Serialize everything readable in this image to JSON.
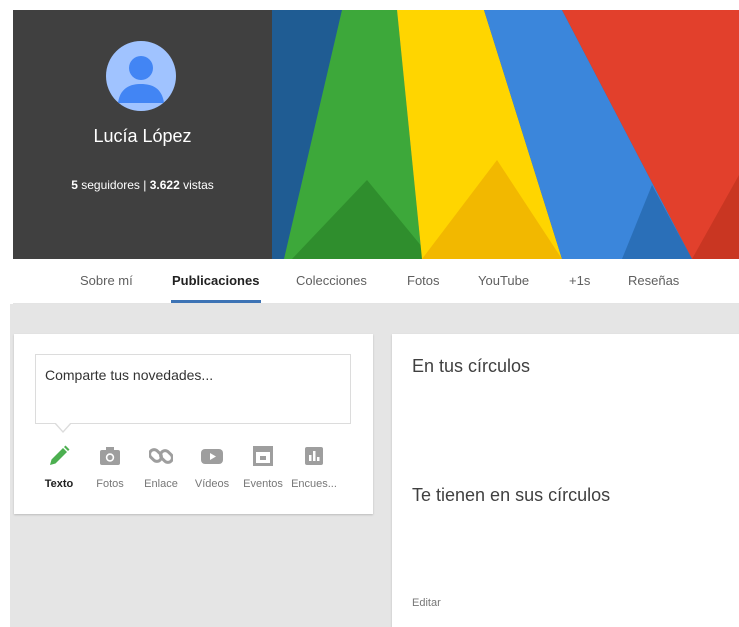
{
  "profile": {
    "name": "Lucía López",
    "followers_count": "5",
    "followers_label": "seguidores",
    "separator": "|",
    "views_count": "3.622",
    "views_label": "vistas"
  },
  "colors": {
    "profile_panel": "#404040",
    "avatar_bg": "#a0c3ff",
    "avatar_fg": "#4285f4",
    "accent_underline": "#3d73b5",
    "page_bg": "#e5e5e5",
    "banner_green": "#3da83a",
    "banner_yellow": "#ffd500",
    "banner_blue": "#3b86db",
    "banner_red": "#e2402c",
    "pencil_green": "#4caf50",
    "icon_grey": "#9e9e9e"
  },
  "tabs": [
    {
      "label": "Sobre mí",
      "active": false
    },
    {
      "label": "Publicaciones",
      "active": true
    },
    {
      "label": "Colecciones",
      "active": false
    },
    {
      "label": "Fotos",
      "active": false
    },
    {
      "label": "YouTube",
      "active": false
    },
    {
      "label": "+1s",
      "active": false
    },
    {
      "label": "Reseñas",
      "active": false
    }
  ],
  "share": {
    "placeholder": "Comparte tus novedades...",
    "actions": [
      {
        "label": "Texto",
        "icon": "pencil-icon",
        "active": true
      },
      {
        "label": "Fotos",
        "icon": "camera-icon",
        "active": false
      },
      {
        "label": "Enlace",
        "icon": "link-icon",
        "active": false
      },
      {
        "label": "Vídeos",
        "icon": "play-icon",
        "active": false
      },
      {
        "label": "Eventos",
        "icon": "calendar-icon",
        "active": false
      },
      {
        "label": "Encues...",
        "icon": "poll-icon",
        "active": false
      }
    ]
  },
  "circles": {
    "in_your_circles": "En tus círculos",
    "have_you_in_circles": "Te tienen en sus círculos",
    "edit_label": "Editar"
  }
}
